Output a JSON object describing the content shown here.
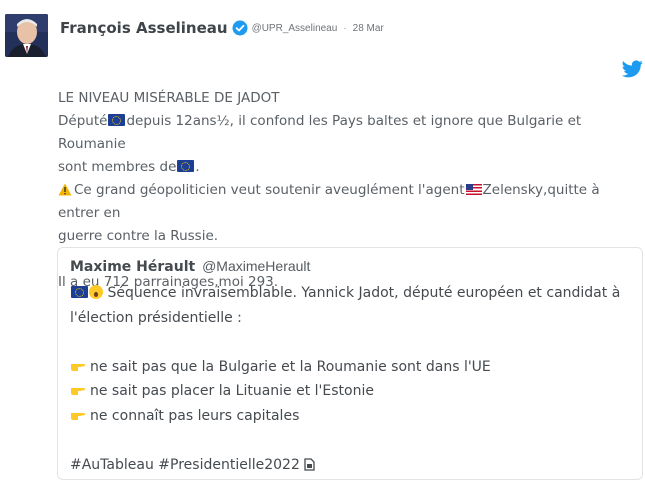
{
  "tweet": {
    "author_name": "François Asselineau",
    "handle": "@UPR_Asselineau",
    "separator": "·",
    "date": "28 Mar",
    "lines": {
      "title": "LE NIVEAU MISÉRABLE DE JADOT",
      "l2a": "Député",
      "l2b": "depuis 12ans½, il confond les Pays baltes et ignore que Bulgarie et Roumanie",
      "l3a": "sont membres de",
      "l3b": ".",
      "l4a": "Ce grand géopoliticien veut soutenir aveuglément l'agent",
      "l4b": "Zelensky,quitte à entrer en",
      "l5": "guerre contre la Russie.",
      "l6": "Il a eu 712 parrainages,moi 293."
    }
  },
  "quoted": {
    "author_name": "Maxime Hérault",
    "handle": "@MaximeHerault",
    "lines": {
      "l1": "Séquence invraisemblable. Yannick Jadot, député européen et candidat à",
      "l2": "l'élection présidentielle :",
      "b1": "ne sait pas que la Bulgarie et la Roumanie sont dans l'UE",
      "b2": "ne sait pas placer la Lituanie et l'Estonie",
      "b3": "ne connaît pas leurs capitales",
      "hashtags": "#AuTableau #Presidentielle2022"
    }
  },
  "icons": {
    "verified": "verified-badge-icon",
    "twitter": "twitter-bird-icon",
    "flag_eu": "eu-flag-icon",
    "flag_us": "us-flag-icon",
    "warning": "warning-icon",
    "pointing": "pointing-right-icon",
    "scream": "screaming-face-icon",
    "document": "document-icon"
  },
  "colors": {
    "twitter_blue": "#1d9bf0",
    "border": "#e1e4e7"
  }
}
